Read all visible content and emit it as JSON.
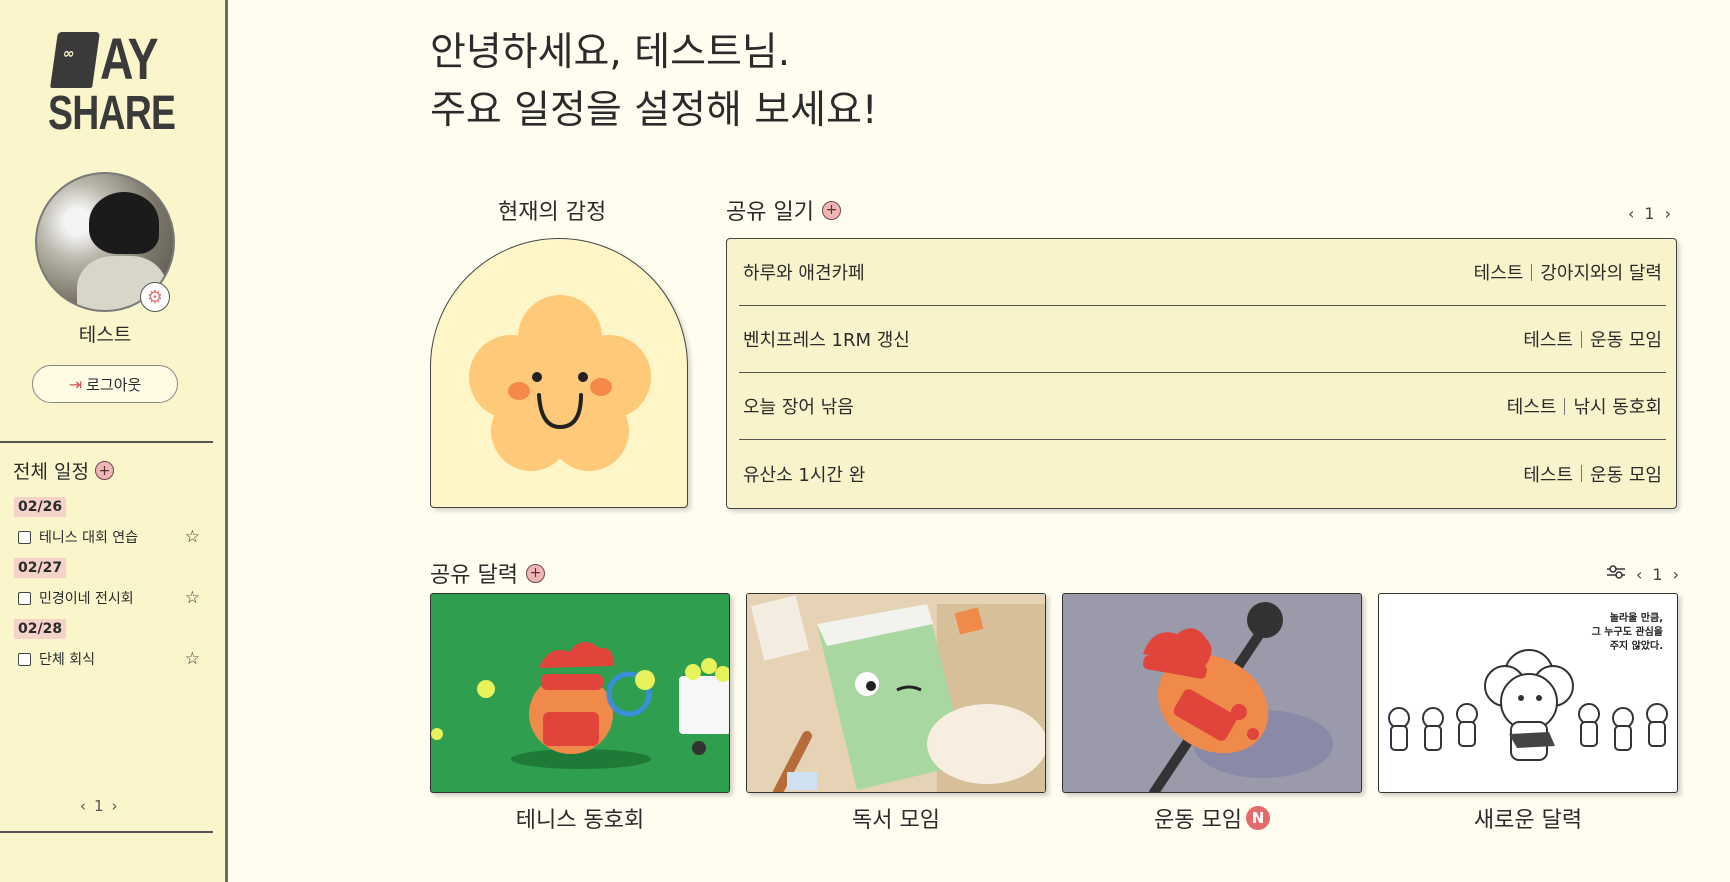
{
  "logo": {
    "top": "AY",
    "bottom": "SHARE",
    "eyes": "∞"
  },
  "profile": {
    "name": "테스트",
    "logout_label": "로그아웃"
  },
  "schedule": {
    "title": "전체 일정",
    "groups": [
      {
        "date": "02/26",
        "item": "테니스 대회 연습"
      },
      {
        "date": "02/27",
        "item": "민경이네 전시회"
      },
      {
        "date": "02/28",
        "item": "단체 회식"
      }
    ],
    "page": "1"
  },
  "greeting": {
    "line1": "안녕하세요, 테스트님.",
    "line2": "주요 일정을 설정해 보세요!"
  },
  "emotion": {
    "title": "현재의 감정"
  },
  "diary": {
    "title": "공유 일기",
    "page": "1",
    "rows": [
      {
        "title": "하루와 애견카페",
        "author": "테스트",
        "calendar": "강아지와의 달력"
      },
      {
        "title": "벤치프레스 1RM 갱신",
        "author": "테스트",
        "calendar": "운동 모임"
      },
      {
        "title": "오늘 장어 낚음",
        "author": "테스트",
        "calendar": "낚시 동호회"
      },
      {
        "title": "유산소 1시간 완",
        "author": "테스트",
        "calendar": "운동 모임"
      }
    ]
  },
  "calendars": {
    "title": "공유 달력",
    "page": "1",
    "items": [
      {
        "name": "테니스 동호회"
      },
      {
        "name": "독서 모임"
      },
      {
        "name": "운동 모임",
        "badge": "N"
      },
      {
        "name": "새로운 달력"
      }
    ],
    "card4_caption": "놀라울 만큼,\n그 누구도 관심을\n주지 않았다."
  },
  "colors": {
    "sidebar_bg": "#fbf5cc",
    "page_bg": "#fffdf0",
    "accent_pink": "#f0b6b6",
    "badge_red": "#e36b6b"
  }
}
